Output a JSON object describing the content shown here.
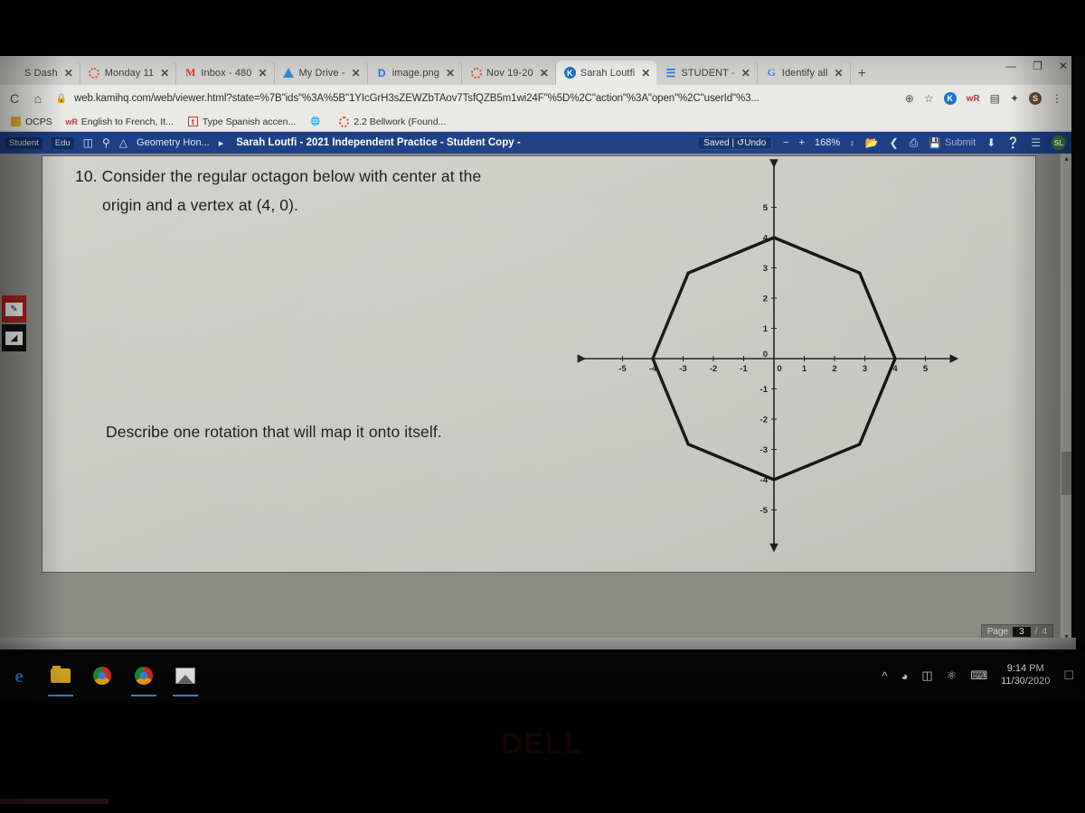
{
  "browser": {
    "tabs": [
      {
        "title": "S Dash",
        "favicon": "generic-icon",
        "active": false
      },
      {
        "title": "Monday 11",
        "favicon": "ring-icon",
        "active": false
      },
      {
        "title": "Inbox - 480",
        "favicon": "gmail-icon",
        "active": false
      },
      {
        "title": "My Drive -",
        "favicon": "drive-icon",
        "active": false
      },
      {
        "title": "image.png",
        "favicon": "docs-icon",
        "active": false
      },
      {
        "title": "Nov 19-20",
        "favicon": "ring-icon",
        "active": false
      },
      {
        "title": "Sarah Loutfi",
        "favicon": "kami-icon",
        "active": true
      },
      {
        "title": "STUDENT -",
        "favicon": "sheets-icon",
        "active": false
      },
      {
        "title": "Identify all",
        "favicon": "google-icon",
        "active": false
      }
    ],
    "new_tab_label": "+",
    "close_label": "✕",
    "window_controls": {
      "minimize": "—",
      "maximize": "❐",
      "close": "✕"
    },
    "reload_icon": "C",
    "home_icon": "⌂",
    "lock_icon": "🔒",
    "url": "web.kamihq.com/web/viewer.html?state=%7B\"ids\"%3A%5B\"1YIcGrH3sZEWZbTAov7TsfQZB5m1wi24F\"%5D%2C\"action\"%3A\"open\"%2C\"userId\"%3...",
    "omni_icons": [
      "install-icon",
      "star-icon",
      "kami-extension-icon",
      "wr-extension-icon",
      "reader-extension-icon",
      "puzzle-extension-icon",
      "profile-avatar",
      "menu-kebab-icon"
    ],
    "bookmarks": [
      {
        "label": "OCPS",
        "icon": "folder-icon"
      },
      {
        "label": "English to French, It...",
        "icon": "wr-icon"
      },
      {
        "label": "Type Spanish accen...",
        "icon": "t-icon"
      },
      {
        "label": "",
        "icon": "globe-icon"
      },
      {
        "label": "2.2 Bellwork (Found...",
        "icon": "ring-icon"
      }
    ]
  },
  "kami": {
    "chips": [
      "Student",
      "Edu"
    ],
    "panel_icon": "sidebar-toggle-icon",
    "search_icon": "search-icon",
    "drive_icon": "drive-icon",
    "breadcrumb_folder": "Geometry Hon...",
    "breadcrumb_arrow": "▸",
    "doc_title": "Sarah Loutfi - 2021 Independent Practice - Student Copy -",
    "saved_label": "Saved",
    "undo_label": "Undo",
    "undo_icon": "↺",
    "zoom_out": "−",
    "zoom_in": "+",
    "zoom_level": "168%",
    "zoom_stepper_icon": "↕",
    "open_icon": "folder-open-icon",
    "share_icon": "share-icon",
    "print_icon": "print-icon",
    "submit_icon": "save-icon",
    "submit_label": "Submit",
    "download_icon": "download-icon",
    "help_icon": "help-icon",
    "menu_icon": "hamburger-icon",
    "avatar_initials": "SL",
    "accent_color": "#1c3f85"
  },
  "tools": {
    "items": [
      {
        "name": "highlight-tool",
        "glyph": "✎",
        "color": "#a62020"
      },
      {
        "name": "shape-tool",
        "glyph": "◢",
        "color": "#111111"
      }
    ]
  },
  "document": {
    "question_number": "10.",
    "line1": "10. Consider the regular octagon below with center at the",
    "line2": "origin and a vertex at (4, 0).",
    "line3": "Describe one rotation that will map it onto itself."
  },
  "chart_data": {
    "type": "scatter",
    "title": "",
    "xlabel": "",
    "ylabel": "",
    "xlim": [
      -6,
      6
    ],
    "ylim": [
      -6,
      6
    ],
    "grid": false,
    "x_ticks": [
      -5,
      -4,
      -3,
      -2,
      -1,
      0,
      1,
      2,
      3,
      4,
      5
    ],
    "x_tick_labels": [
      "-5",
      "-4",
      "-3",
      "-2",
      "-1",
      "0",
      "1",
      "2",
      "3",
      "4",
      "5"
    ],
    "y_ticks": [
      -5,
      -4,
      -3,
      -2,
      -1,
      0,
      1,
      2,
      3,
      4,
      5
    ],
    "y_tick_labels": [
      "-5",
      "-4",
      "-3",
      "-2",
      "-1",
      "0",
      "1",
      "2",
      "3",
      "4",
      "5"
    ],
    "series": [
      {
        "name": "regular octagon",
        "type": "polygon",
        "closed": true,
        "stroke": "#111111",
        "points": [
          [
            4,
            0
          ],
          [
            2.83,
            2.83
          ],
          [
            0,
            4
          ],
          [
            -2.83,
            2.83
          ],
          [
            -4,
            0
          ],
          [
            -2.83,
            -2.83
          ],
          [
            0,
            -4
          ],
          [
            2.83,
            -2.83
          ]
        ]
      }
    ],
    "annotations": [
      "center at origin",
      "vertex at (4, 0)"
    ]
  },
  "viewer": {
    "page_label": "Page",
    "page_current": "3",
    "page_sep": "/",
    "page_total": "4",
    "scroll_up_icon": "▲",
    "scroll_down_icon": "▼"
  },
  "taskbar": {
    "apps": [
      {
        "name": "edge-icon",
        "label": "e"
      },
      {
        "name": "file-explorer-icon",
        "label": ""
      },
      {
        "name": "chrome-icon",
        "label": ""
      },
      {
        "name": "chrome-icon",
        "label": ""
      },
      {
        "name": "photos-icon",
        "label": ""
      }
    ],
    "tray": [
      "chevron-up-icon",
      "wifi-icon",
      "battery-icon",
      "bluetooth-icon",
      "keyboard-icon"
    ],
    "time": "9:14 PM",
    "date": "11/30/2020",
    "action_center_icon": "🗪"
  },
  "hardware": {
    "brand": "DELL"
  }
}
